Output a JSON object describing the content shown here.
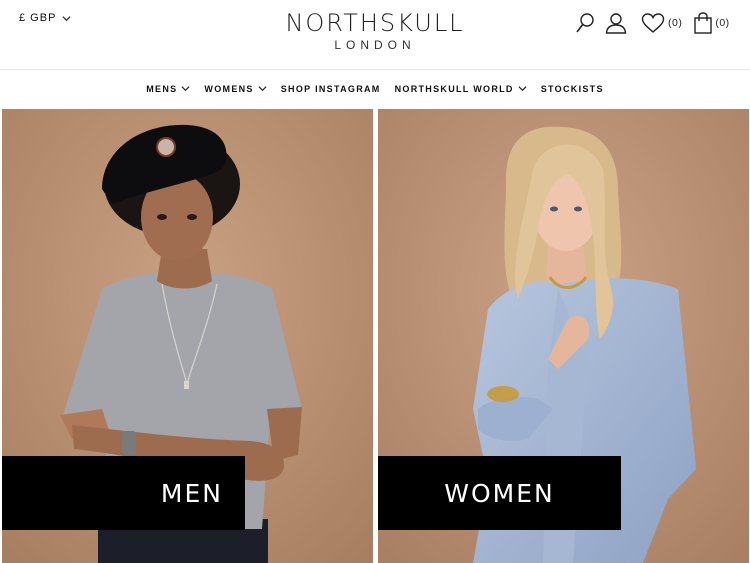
{
  "header": {
    "currency": "£ GBP",
    "logo_main": "NORTHSKULL",
    "logo_sub": "LONDON",
    "wishlist_count": "(0)",
    "cart_count": "(0)"
  },
  "nav": {
    "items": [
      "MENS",
      "WOMENS",
      "SHOP INSTAGRAM",
      "NORTHSKULL WORLD",
      "STOCKISTS"
    ]
  },
  "tiles": {
    "men_label": "MEN",
    "women_label": "WOMEN"
  },
  "colors": {
    "backdrop": "#c39a7b",
    "label_bg": "#000000",
    "label_text": "#ffffff"
  }
}
